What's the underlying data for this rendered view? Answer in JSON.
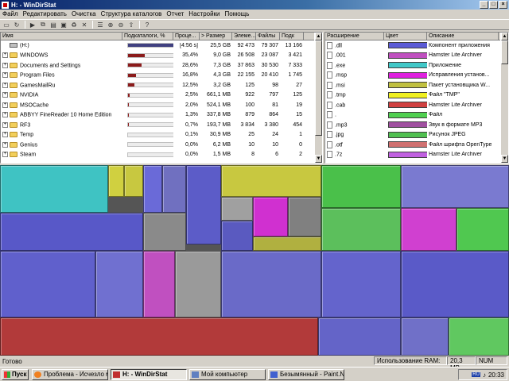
{
  "window": {
    "title": "H: - WinDirStat"
  },
  "menu": [
    "Файл",
    "Редактировать",
    "Очистка",
    "Структура каталогов",
    "Отчет",
    "Настройки",
    "Помощь"
  ],
  "tree": {
    "columns": [
      "Имя",
      "Подкаталоги, %",
      "Проце...",
      "> Размер",
      "Элеме...",
      "Файлы",
      "Подк"
    ],
    "rows": [
      {
        "name": "(H:)",
        "pct": "[4:56 s]",
        "size": "25,5 GB",
        "items": "92 473",
        "files": "79 307",
        "subdirs": "13 166",
        "fill": 1.0,
        "root": true
      },
      {
        "name": "WINDOWS",
        "pct": "35,4%",
        "size": "9,0 GB",
        "items": "26 508",
        "files": "23 087",
        "subdirs": "3 421",
        "fill": 0.354
      },
      {
        "name": "Documents and Settings",
        "pct": "28,6%",
        "size": "7,3 GB",
        "items": "37 863",
        "files": "30 530",
        "subdirs": "7 333",
        "fill": 0.286
      },
      {
        "name": "Program Files",
        "pct": "16,8%",
        "size": "4,3 GB",
        "items": "22 155",
        "files": "20 410",
        "subdirs": "1 745",
        "fill": 0.168
      },
      {
        "name": "GamesMailRu",
        "pct": "12,5%",
        "size": "3,2 GB",
        "items": "125",
        "files": "98",
        "subdirs": "27",
        "fill": 0.125
      },
      {
        "name": "NVIDIA",
        "pct": "2,5%",
        "size": "661,1 MB",
        "items": "922",
        "files": "797",
        "subdirs": "125",
        "fill": 0.025
      },
      {
        "name": "MSOCache",
        "pct": "2,0%",
        "size": "524,1 MB",
        "items": "100",
        "files": "81",
        "subdirs": "19",
        "fill": 0.02
      },
      {
        "name": "ABBYY FineReader 10 Home Edition",
        "pct": "1,3%",
        "size": "337,8 MB",
        "items": "879",
        "files": "864",
        "subdirs": "15",
        "fill": 0.013
      },
      {
        "name": "RF3",
        "pct": "0,7%",
        "size": "193,7 MB",
        "items": "3 834",
        "files": "3 380",
        "subdirs": "454",
        "fill": 0.007
      },
      {
        "name": "Temp",
        "pct": "0,1%",
        "size": "30,9 MB",
        "items": "25",
        "files": "24",
        "subdirs": "1",
        "fill": 0.001
      },
      {
        "name": "Genius",
        "pct": "0,0%",
        "size": "6,2 MB",
        "items": "10",
        "files": "10",
        "subdirs": "0",
        "fill": 0.0
      },
      {
        "name": "Steam",
        "pct": "0,0%",
        "size": "1,5 MB",
        "items": "8",
        "files": "6",
        "subdirs": "2",
        "fill": 0.0
      }
    ]
  },
  "extensions": {
    "columns": [
      "Расширение",
      "Цвет",
      "Описание"
    ],
    "rows": [
      {
        "ext": ".dll",
        "color": "#5b5bd6",
        "desc": "Компонент приложения"
      },
      {
        "ext": ".001",
        "color": "#c050c0",
        "desc": "Hamster Lite Archiver"
      },
      {
        "ext": ".exe",
        "color": "#40c8c8",
        "desc": "Приложение"
      },
      {
        "ext": ".msp",
        "color": "#e020e0",
        "desc": "Исправления установ..."
      },
      {
        "ext": ".msi",
        "color": "#c0c040",
        "desc": "Пакет установщика W..."
      },
      {
        "ext": ".tmp",
        "color": "#f0f020",
        "desc": "Файл \"TMP\""
      },
      {
        "ext": ".cab",
        "color": "#d04040",
        "desc": "Hamster Lite Archiver"
      },
      {
        "ext": ".",
        "color": "#50d050",
        "desc": "Файл"
      },
      {
        "ext": ".mp3",
        "color": "#a050a0",
        "desc": "Звук в формате MP3"
      },
      {
        "ext": ".jpg",
        "color": "#50c050",
        "desc": "Рисунок JPEG"
      },
      {
        "ext": ".otf",
        "color": "#d07070",
        "desc": "Файл шрифта OpenType"
      },
      {
        "ext": ".7z",
        "color": "#c060e0",
        "desc": "Hamster Lite Archiver"
      }
    ]
  },
  "status": {
    "ready": "Готово",
    "ram_label": "Использование RAM:",
    "ram_value": "20,3 MB",
    "num": "NUM"
  },
  "taskbar": {
    "start": "Пуск",
    "tasks": [
      "Проблема - Исчезло мес...",
      "H: - WinDirStat",
      "Мой компьютер",
      "Безымянный - Paint.NET..."
    ],
    "lang": "RU",
    "clock": "20:33"
  }
}
